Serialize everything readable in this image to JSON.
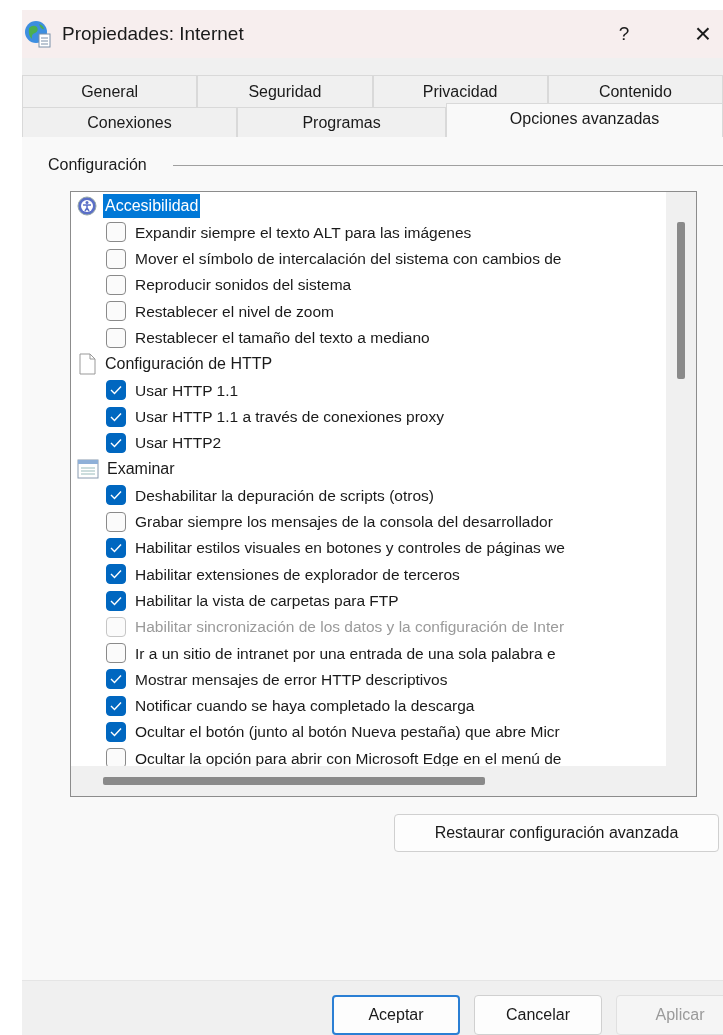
{
  "window": {
    "title": "Propiedades: Internet",
    "help": "?",
    "close": "×"
  },
  "tab_rows": [
    [
      {
        "label": "General",
        "selected": false
      },
      {
        "label": "Seguridad",
        "selected": false
      },
      {
        "label": "Privacidad",
        "selected": false
      },
      {
        "label": "Contenido",
        "selected": false
      }
    ],
    [
      {
        "label": "Conexiones",
        "selected": false
      },
      {
        "label": "Programas",
        "selected": false
      },
      {
        "label": "Opciones avanzadas",
        "selected": true
      }
    ]
  ],
  "settings": {
    "legend": "Configuración",
    "groups": [
      {
        "label": "Accesibilidad",
        "kind": "accessibility",
        "selected": true,
        "options": [
          {
            "label": "Expandir siempre el texto ALT para las imágenes",
            "checked": false,
            "disabled": false
          },
          {
            "label": "Mover el símbolo de intercalación del sistema con cambios de",
            "checked": false,
            "disabled": false
          },
          {
            "label": "Reproducir sonidos del sistema",
            "checked": false,
            "disabled": false
          },
          {
            "label": "Restablecer el nivel de zoom",
            "checked": false,
            "disabled": false
          },
          {
            "label": "Restablecer el tamaño del texto a mediano",
            "checked": false,
            "disabled": false
          }
        ]
      },
      {
        "label": "Configuración de HTTP",
        "kind": "page",
        "selected": false,
        "options": [
          {
            "label": "Usar HTTP 1.1",
            "checked": true,
            "disabled": false
          },
          {
            "label": "Usar HTTP 1.1 a través de conexiones proxy",
            "checked": true,
            "disabled": false
          },
          {
            "label": "Usar HTTP2",
            "checked": true,
            "disabled": false
          }
        ]
      },
      {
        "label": "Examinar",
        "kind": "window",
        "selected": false,
        "options": [
          {
            "label": "Deshabilitar la depuración de scripts (otros)",
            "checked": true,
            "disabled": false
          },
          {
            "label": "Grabar siempre los mensajes de la consola del desarrollador",
            "checked": false,
            "disabled": false
          },
          {
            "label": "Habilitar estilos visuales en botones y controles de páginas we",
            "checked": true,
            "disabled": false
          },
          {
            "label": "Habilitar extensiones de explorador de terceros",
            "checked": true,
            "disabled": false
          },
          {
            "label": "Habilitar la vista de carpetas para FTP",
            "checked": true,
            "disabled": false
          },
          {
            "label": "Habilitar sincronización de los datos y la configuración de Inter",
            "checked": false,
            "disabled": true
          },
          {
            "label": "Ir a un sitio de intranet por una entrada de una sola palabra e",
            "checked": false,
            "disabled": false
          },
          {
            "label": "Mostrar mensajes de error HTTP descriptivos",
            "checked": true,
            "disabled": false
          },
          {
            "label": "Notificar cuando se haya completado la descarga",
            "checked": true,
            "disabled": false
          },
          {
            "label": "Ocultar el botón (junto al botón Nueva pestaña) que abre Micr",
            "checked": true,
            "disabled": false
          },
          {
            "label": "Ocultar la opción para abrir con Microsoft Edge en el menú de",
            "checked": false,
            "disabled": false
          }
        ]
      }
    ],
    "restore_button": "Restaurar configuración avanzada"
  },
  "buttons": [
    {
      "label": "Aceptar",
      "default": true,
      "disabled": false
    },
    {
      "label": "Cancelar",
      "default": false,
      "disabled": false
    },
    {
      "label": "Aplicar",
      "default": false,
      "disabled": true
    }
  ]
}
